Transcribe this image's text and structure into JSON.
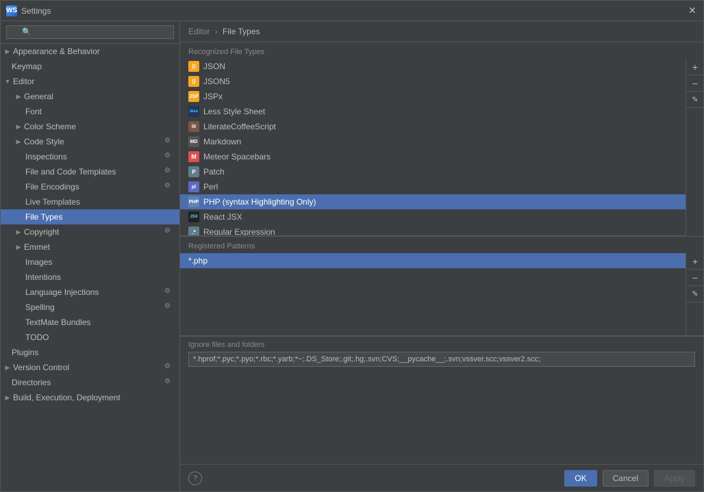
{
  "window": {
    "title": "Settings",
    "icon": "WS"
  },
  "breadcrumb": {
    "parent": "Editor",
    "separator": "›",
    "current": "File Types"
  },
  "search": {
    "placeholder": "🔍"
  },
  "sidebar": {
    "items": [
      {
        "id": "appearance",
        "label": "Appearance & Behavior",
        "level": 0,
        "expandable": true,
        "expanded": false,
        "hasIcon": false
      },
      {
        "id": "keymap",
        "label": "Keymap",
        "level": 1,
        "expandable": false,
        "expanded": false,
        "hasIcon": false
      },
      {
        "id": "editor",
        "label": "Editor",
        "level": 0,
        "expandable": true,
        "expanded": true,
        "hasIcon": false
      },
      {
        "id": "general",
        "label": "General",
        "level": 1,
        "expandable": true,
        "expanded": false,
        "hasIcon": false
      },
      {
        "id": "font",
        "label": "Font",
        "level": 2,
        "expandable": false,
        "expanded": false,
        "hasIcon": false
      },
      {
        "id": "color-scheme",
        "label": "Color Scheme",
        "level": 1,
        "expandable": true,
        "expanded": false,
        "hasIcon": false
      },
      {
        "id": "code-style",
        "label": "Code Style",
        "level": 1,
        "expandable": true,
        "expanded": false,
        "hasIcon": true
      },
      {
        "id": "inspections",
        "label": "Inspections",
        "level": 2,
        "expandable": false,
        "expanded": false,
        "hasIcon": true
      },
      {
        "id": "file-and-code-templates",
        "label": "File and Code Templates",
        "level": 2,
        "expandable": false,
        "expanded": false,
        "hasIcon": true
      },
      {
        "id": "file-encodings",
        "label": "File Encodings",
        "level": 2,
        "expandable": false,
        "expanded": false,
        "hasIcon": true
      },
      {
        "id": "live-templates",
        "label": "Live Templates",
        "level": 2,
        "expandable": false,
        "expanded": false,
        "hasIcon": false
      },
      {
        "id": "file-types",
        "label": "File Types",
        "level": 2,
        "expandable": false,
        "expanded": false,
        "hasIcon": false,
        "selected": true
      },
      {
        "id": "copyright",
        "label": "Copyright",
        "level": 1,
        "expandable": true,
        "expanded": false,
        "hasIcon": true
      },
      {
        "id": "emmet",
        "label": "Emmet",
        "level": 1,
        "expandable": true,
        "expanded": false,
        "hasIcon": false
      },
      {
        "id": "images",
        "label": "Images",
        "level": 2,
        "expandable": false,
        "expanded": false,
        "hasIcon": false
      },
      {
        "id": "intentions",
        "label": "Intentions",
        "level": 2,
        "expandable": false,
        "expanded": false,
        "hasIcon": false
      },
      {
        "id": "language-injections",
        "label": "Language Injections",
        "level": 2,
        "expandable": false,
        "expanded": false,
        "hasIcon": true
      },
      {
        "id": "spelling",
        "label": "Spelling",
        "level": 2,
        "expandable": false,
        "expanded": false,
        "hasIcon": true
      },
      {
        "id": "textmate-bundles",
        "label": "TextMate Bundles",
        "level": 2,
        "expandable": false,
        "expanded": false,
        "hasIcon": false
      },
      {
        "id": "todo",
        "label": "TODO",
        "level": 2,
        "expandable": false,
        "expanded": false,
        "hasIcon": false
      },
      {
        "id": "plugins",
        "label": "Plugins",
        "level": 0,
        "expandable": false,
        "expanded": false,
        "hasIcon": false
      },
      {
        "id": "version-control",
        "label": "Version Control",
        "level": 0,
        "expandable": true,
        "expanded": false,
        "hasIcon": true
      },
      {
        "id": "directories",
        "label": "Directories",
        "level": 0,
        "expandable": false,
        "expanded": false,
        "hasIcon": true
      },
      {
        "id": "build-execution-deployment",
        "label": "Build, Execution, Deployment",
        "level": 0,
        "expandable": true,
        "expanded": false,
        "hasIcon": false
      }
    ]
  },
  "recognized_file_types": {
    "label": "Recognized File Types",
    "items": [
      {
        "id": "json",
        "name": "JSON",
        "iconClass": "icon-json",
        "iconText": "{}"
      },
      {
        "id": "json5",
        "name": "JSON5",
        "iconClass": "icon-json",
        "iconText": "{}"
      },
      {
        "id": "jspx",
        "name": "JSPx",
        "iconClass": "icon-jsp",
        "iconText": "JSP"
      },
      {
        "id": "less",
        "name": "Less Style Sheet",
        "iconClass": "icon-less",
        "iconText": "less"
      },
      {
        "id": "literate",
        "name": "LiterateCoffeeScript",
        "iconClass": "icon-lit",
        "iconText": "lit"
      },
      {
        "id": "markdown",
        "name": "Markdown",
        "iconClass": "icon-md",
        "iconText": "MD"
      },
      {
        "id": "meteor",
        "name": "Meteor Spacebars",
        "iconClass": "icon-meteor",
        "iconText": "M"
      },
      {
        "id": "patch",
        "name": "Patch",
        "iconClass": "icon-patch",
        "iconText": "P"
      },
      {
        "id": "perl",
        "name": "Perl",
        "iconClass": "icon-perl",
        "iconText": "pl"
      },
      {
        "id": "php",
        "name": "PHP (syntax Highlighting Only)",
        "iconClass": "icon-php",
        "iconText": "PHP",
        "selected": true
      },
      {
        "id": "react-jsx",
        "name": "React JSX",
        "iconClass": "icon-react",
        "iconText": "JSX"
      },
      {
        "id": "regex",
        "name": "Regular Expression",
        "iconClass": "icon-regex",
        "iconText": ".*"
      }
    ],
    "controls": [
      "+",
      "−",
      "✎"
    ]
  },
  "registered_patterns": {
    "label": "Registered Patterns",
    "items": [
      {
        "id": "php-pattern",
        "name": "*.php",
        "selected": true
      }
    ],
    "controls": [
      "+",
      "−",
      "✎"
    ]
  },
  "ignore_files": {
    "label": "Ignore files and folders",
    "value": "*.hprof;*.pyc;*.pyo;*.rbc;*.yarb;*~;.DS_Store;.git;.hg;.svn;CVS;__pycache__;.svn;vssver.scc;vssver2.scc;"
  },
  "footer": {
    "ok_label": "OK",
    "cancel_label": "Cancel",
    "apply_label": "Apply",
    "help_label": "?"
  }
}
